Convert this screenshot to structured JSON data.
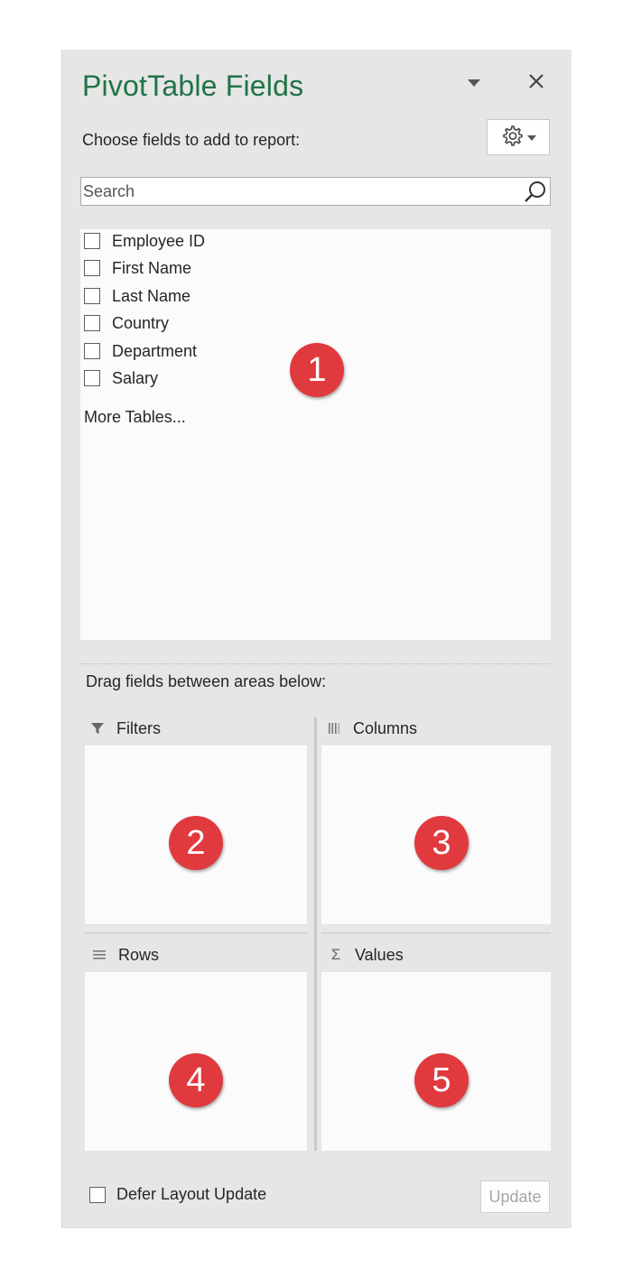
{
  "pane": {
    "title": "PivotTable Fields",
    "subtitle": "Choose fields to add to report:",
    "menu_icon": "chevron-down-icon",
    "close_icon": "close-icon",
    "tools_icon": "gear-icon"
  },
  "search": {
    "placeholder": "Search",
    "value": ""
  },
  "fields": [
    {
      "label": "Employee ID",
      "checked": false
    },
    {
      "label": "First Name",
      "checked": false
    },
    {
      "label": "Last Name",
      "checked": false
    },
    {
      "label": "Country",
      "checked": false
    },
    {
      "label": "Department",
      "checked": false
    },
    {
      "label": "Salary",
      "checked": false
    }
  ],
  "more_tables": "More Tables...",
  "drag_label": "Drag fields between areas below:",
  "areas": {
    "filters": {
      "label": "Filters",
      "icon": "filter-icon"
    },
    "columns": {
      "label": "Columns",
      "icon": "columns-icon"
    },
    "rows": {
      "label": "Rows",
      "icon": "rows-icon"
    },
    "values": {
      "label": "Values",
      "icon": "sigma-icon"
    }
  },
  "badges": [
    "1",
    "2",
    "3",
    "4",
    "5"
  ],
  "defer": {
    "label": "Defer Layout Update",
    "checked": false
  },
  "update_button": "Update",
  "colors": {
    "title_green": "#217346",
    "badge_red": "#e03a3e",
    "pane_bg": "#e6e6e6",
    "area_bg": "#fbfbfb"
  }
}
